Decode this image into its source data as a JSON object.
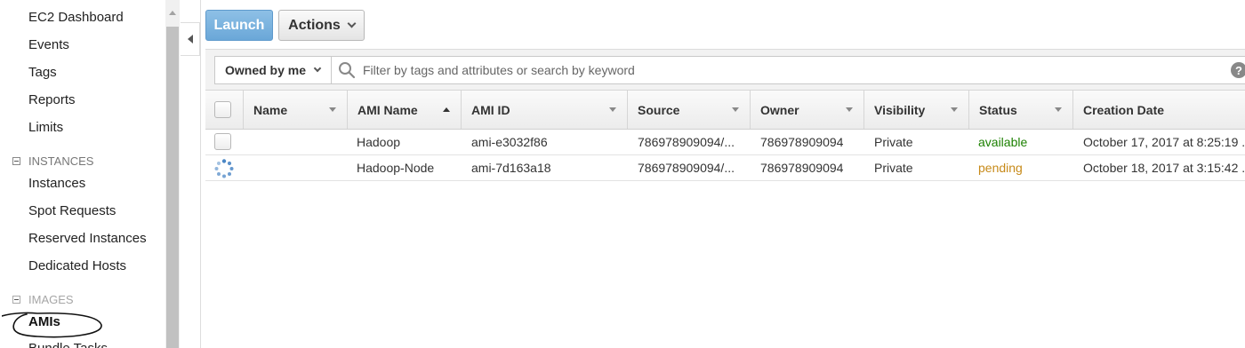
{
  "sidebar": {
    "items": [
      {
        "label": "EC2 Dashboard"
      },
      {
        "label": "Events"
      },
      {
        "label": "Tags"
      },
      {
        "label": "Reports"
      },
      {
        "label": "Limits"
      }
    ],
    "instances_section": "INSTANCES",
    "instances_items": [
      {
        "label": "Instances"
      },
      {
        "label": "Spot Requests"
      },
      {
        "label": "Reserved Instances"
      },
      {
        "label": "Dedicated Hosts"
      }
    ],
    "images_section": "IMAGES",
    "images_items": [
      {
        "label": "AMIs"
      },
      {
        "label": "Bundle Tasks"
      }
    ]
  },
  "toolbar": {
    "launch_label": "Launch",
    "actions_label": "Actions"
  },
  "filter": {
    "owner_label": "Owned by me",
    "search_placeholder": "Filter by tags and attributes or search by keyword",
    "help_label": "?"
  },
  "table": {
    "columns": [
      "Name",
      "AMI Name",
      "AMI ID",
      "Source",
      "Owner",
      "Visibility",
      "Status",
      "Creation Date"
    ],
    "rows": [
      {
        "name": "",
        "ami_name": "Hadoop",
        "ami_id": "ami-e3032f86",
        "source": "786978909094/...",
        "owner": "786978909094",
        "visibility": "Private",
        "status": "available",
        "creation_date": "October 17, 2017 at 8:25:19 ..."
      },
      {
        "name": "",
        "ami_name": "Hadoop-Node",
        "ami_id": "ami-7d163a18",
        "source": "786978909094/...",
        "owner": "786978909094",
        "visibility": "Private",
        "status": "pending",
        "creation_date": "October 18, 2017 at 3:15:42 ..."
      }
    ]
  },
  "colors": {
    "status_available": "#1d8102",
    "status_pending": "#c78a19",
    "launch_button": "#6aa7d8"
  },
  "icons": {
    "search": "search-icon",
    "help": "help-icon",
    "spinner": "loading-spinner-icon",
    "collapse": "collapse-left-icon"
  }
}
